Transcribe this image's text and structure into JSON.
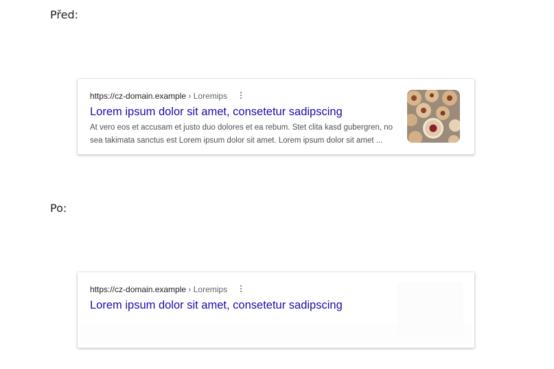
{
  "labels": {
    "before": "Před:",
    "after": "Po:"
  },
  "results": {
    "before": {
      "url": "https://cz-domain.example",
      "breadcrumb": "› Loremips",
      "title": "Lorem ipsum dolor sit amet, consetetur sadipscing",
      "snippet": "At vero eos et accusam et justo duo dolores et ea rebum. Stet clita kasd gubergren, no sea takimata sanctus est Lorem ipsum dolor sit amet. Lorem ipsum dolor sit amet ...",
      "thumbnail_icon": "cookies-thumbnail-icon"
    },
    "after": {
      "url": "https://cz-domain.example",
      "breadcrumb": "› Loremips",
      "title": "Lorem ipsum dolor sit amet, consetetur sadipscing"
    }
  },
  "colors": {
    "title_link": "#1a0dab",
    "snippet": "#4d5156",
    "url": "#202124",
    "breadcrumb": "#5f6368"
  }
}
